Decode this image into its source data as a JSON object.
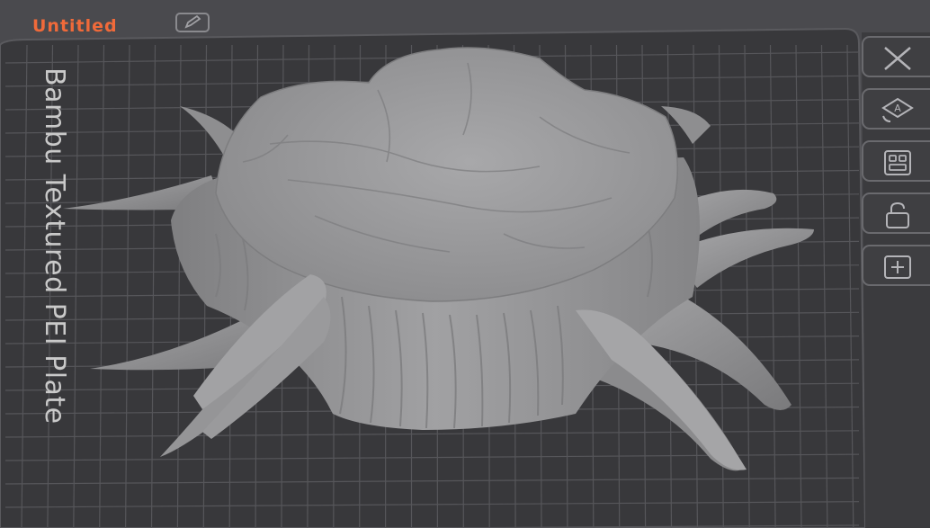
{
  "plate": {
    "name": "Untitled",
    "type_label": "Bambu Textured PEI Plate"
  },
  "toolbar": {
    "items": [
      {
        "icon": "close-icon"
      },
      {
        "icon": "auto-orient-icon"
      },
      {
        "icon": "arrange-icon"
      },
      {
        "icon": "lock-icon"
      },
      {
        "icon": "plate-settings-icon"
      }
    ]
  },
  "colors": {
    "background": "#4a4a4e",
    "plate": "#37373a",
    "grid": "#55555a",
    "title_accent": "#f06a3a",
    "model": "#9d9d9f"
  }
}
